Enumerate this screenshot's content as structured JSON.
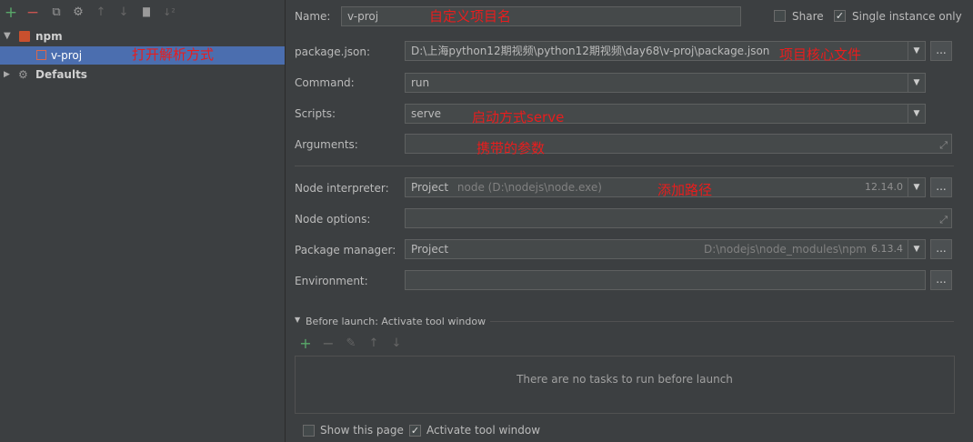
{
  "toolbar": {
    "add_icon": "+",
    "remove_icon": "−",
    "copy_icon": "⧉",
    "settings_icon": "⚙",
    "up_icon": "↑",
    "down_icon": "↓",
    "folder_icon": "▇",
    "sort_icon": "↓²"
  },
  "tree": {
    "npm_label": "npm",
    "npm_toggle": "▼",
    "vproj_label": "v-proj",
    "defaults_label": "Defaults",
    "defaults_toggle": "▶"
  },
  "annotations": {
    "open_method": "打开解析方式",
    "name_hint": "自定义项目名",
    "package_hint": "项目核心文件",
    "scripts_hint": "启动方式serve",
    "args_hint": "携带的参数",
    "path_hint": "添加路径"
  },
  "form": {
    "name_label": "Name:",
    "name_value": "v-proj",
    "share_label": "Share",
    "single_instance_label": "Single instance only",
    "package_json_label": "package.json:",
    "package_json_value": "D:\\上海python12期视频\\python12期视频\\day68\\v-proj\\package.json",
    "command_label": "Command:",
    "command_value": "run",
    "scripts_label": "Scripts:",
    "scripts_value": "serve",
    "arguments_label": "Arguments:",
    "node_interpreter_label": "Node interpreter:",
    "node_interpreter_project": "Project",
    "node_interpreter_path": "node (D:\\nodejs\\node.exe)",
    "node_interpreter_version": "12.14.0",
    "node_options_label": "Node options:",
    "package_manager_label": "Package manager:",
    "package_manager_value": "Project",
    "package_manager_path": "D:\\nodejs\\node_modules\\npm",
    "package_manager_version": "6.13.4",
    "environment_label": "Environment:",
    "browse": "...",
    "dropdown_arrow": "▼",
    "expand": "⤢"
  },
  "before_launch": {
    "header": "Before launch: Activate tool window",
    "toggle": "▼",
    "empty_text": "There are no tasks to run before launch",
    "add": "+",
    "remove": "−",
    "edit": "✎",
    "up": "↑",
    "down": "↓"
  },
  "footer": {
    "show_page_label": "Show this page",
    "activate_label": "Activate tool window",
    "check": "✓"
  },
  "colors": {
    "selection": "#4b6eaf",
    "annotation": "#e81d1d",
    "add_green": "#59a869",
    "remove_red": "#c75450"
  }
}
